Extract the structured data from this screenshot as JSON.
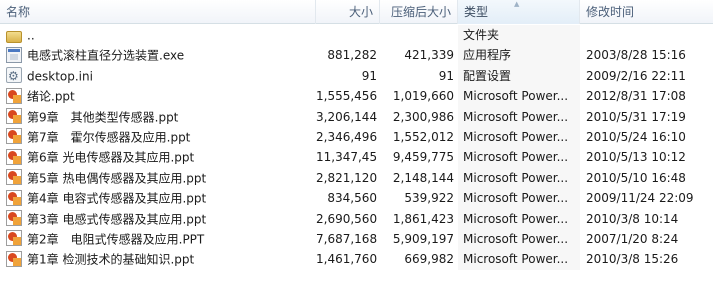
{
  "columns": {
    "name": "名称",
    "size": "大小",
    "packed": "压缩后大小",
    "type": "类型",
    "modified": "修改时间"
  },
  "rows": [
    {
      "icon": "folder-icon",
      "name": "..",
      "size": "",
      "packed": "",
      "type": "文件夹",
      "modified": ""
    },
    {
      "icon": "exe-file-icon",
      "name": "电感式滚柱直径分选装置.exe",
      "size": "881,282",
      "packed": "421,339",
      "type": "应用程序",
      "modified": "2003/8/28 15:16"
    },
    {
      "icon": "ini-file-icon",
      "name": "desktop.ini",
      "size": "91",
      "packed": "91",
      "type": "配置设置",
      "modified": "2009/2/16 22:11"
    },
    {
      "icon": "ppt-file-icon",
      "name": "绪论.ppt",
      "size": "1,555,456",
      "packed": "1,019,660",
      "type": "Microsoft Power...",
      "modified": "2012/8/31 17:08"
    },
    {
      "icon": "ppt-file-icon",
      "name": "第9章　其他类型传感器.ppt",
      "size": "3,206,144",
      "packed": "2,300,986",
      "type": "Microsoft Power...",
      "modified": "2010/5/31 17:19"
    },
    {
      "icon": "ppt-file-icon",
      "name": "第7章　霍尔传感器及应用.ppt",
      "size": "2,346,496",
      "packed": "1,552,012",
      "type": "Microsoft Power...",
      "modified": "2010/5/24 16:10"
    },
    {
      "icon": "ppt-file-icon",
      "name": "第6章 光电传感器及其应用.ppt",
      "size": "11,347,456",
      "packed": "9,459,775",
      "type": "Microsoft Power...",
      "modified": "2010/5/13 10:12"
    },
    {
      "icon": "ppt-file-icon",
      "name": "第5章 热电偶传感器及其应用.ppt",
      "size": "2,821,120",
      "packed": "2,148,144",
      "type": "Microsoft Power...",
      "modified": "2010/5/10 16:48"
    },
    {
      "icon": "ppt-file-icon",
      "name": "第4章 电容式传感器及其应用.ppt",
      "size": "834,560",
      "packed": "539,922",
      "type": "Microsoft Power...",
      "modified": "2009/11/24 22:09"
    },
    {
      "icon": "ppt-file-icon",
      "name": "第3章 电感式传感器及其应用.ppt",
      "size": "2,690,560",
      "packed": "1,861,423",
      "type": "Microsoft Power...",
      "modified": "2010/3/8 10:14"
    },
    {
      "icon": "ppt-file-icon",
      "name": "第2章　电阻式传感器及应用.PPT",
      "size": "7,687,168",
      "packed": "5,909,197",
      "type": "Microsoft Power...",
      "modified": "2007/1/20 8:24"
    },
    {
      "icon": "ppt-file-icon",
      "name": "第1章 检测技术的基础知识.ppt",
      "size": "1,461,760",
      "packed": "669,982",
      "type": "Microsoft Power...",
      "modified": "2010/3/8 15:26"
    }
  ]
}
